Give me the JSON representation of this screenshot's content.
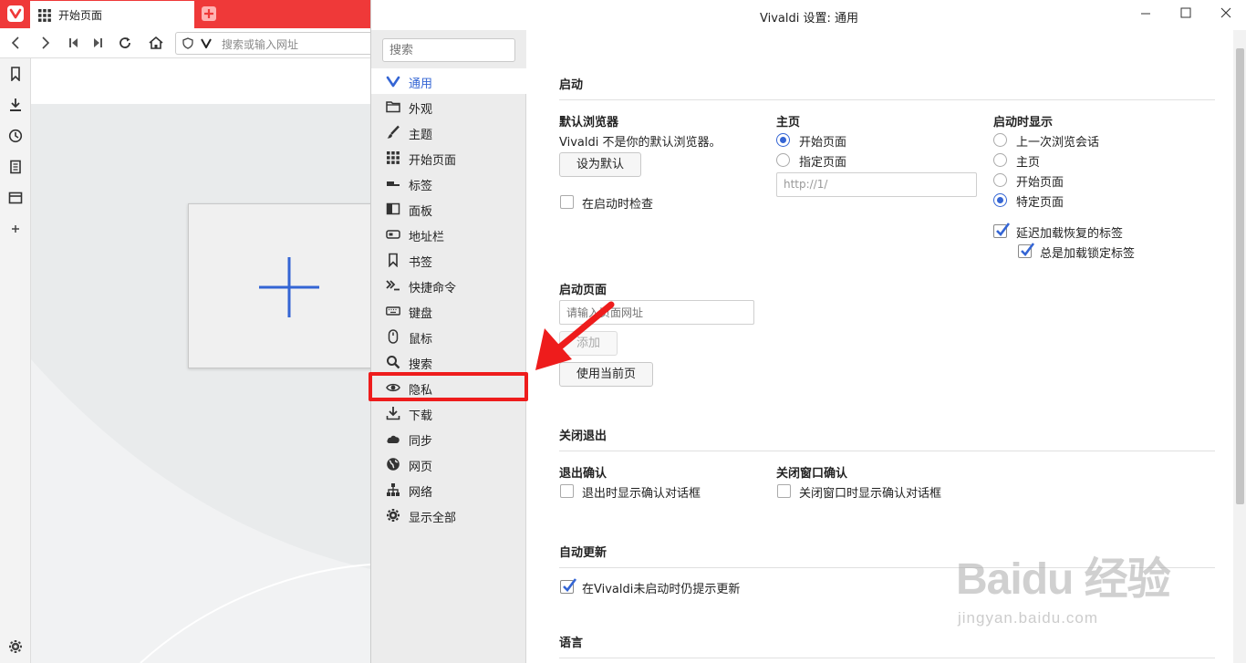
{
  "browser": {
    "tab_title": "开始页面",
    "address_placeholder": "搜索或输入网址"
  },
  "window": {
    "title": "Vivaldi 设置: 通用"
  },
  "nav": {
    "search_placeholder": "搜索",
    "items": [
      {
        "label": "通用",
        "icon": "vivaldi-icon",
        "active": true
      },
      {
        "label": "外观",
        "icon": "folder-icon"
      },
      {
        "label": "主题",
        "icon": "brush-icon"
      },
      {
        "label": "开始页面",
        "icon": "grid-icon"
      },
      {
        "label": "标签",
        "icon": "tabs-icon"
      },
      {
        "label": "面板",
        "icon": "panel-icon"
      },
      {
        "label": "地址栏",
        "icon": "address-bar-icon"
      },
      {
        "label": "书签",
        "icon": "bookmark-icon"
      },
      {
        "label": "快捷命令",
        "icon": "quick-command-icon"
      },
      {
        "label": "键盘",
        "icon": "keyboard-icon"
      },
      {
        "label": "鼠标",
        "icon": "mouse-icon"
      },
      {
        "label": "搜索",
        "icon": "search-icon"
      },
      {
        "label": "隐私",
        "icon": "eye-icon"
      },
      {
        "label": "下载",
        "icon": "download-icon"
      },
      {
        "label": "同步",
        "icon": "cloud-icon"
      },
      {
        "label": "网页",
        "icon": "globe-icon"
      },
      {
        "label": "网络",
        "icon": "network-icon"
      },
      {
        "label": "显示全部",
        "icon": "gear-icon"
      }
    ]
  },
  "startup": {
    "heading": "启动",
    "default_browser": {
      "title": "默认浏览器",
      "status": "Vivaldi 不是你的默认浏览器。",
      "button": "设为默认",
      "check_label": "在启动时检查",
      "checked": false
    },
    "homepage": {
      "title": "主页",
      "options": [
        {
          "label": "开始页面",
          "selected": true
        },
        {
          "label": "指定页面",
          "selected": false
        }
      ],
      "url_value": "http://1/"
    },
    "on_startup": {
      "title": "启动时显示",
      "options": [
        {
          "label": "上一次浏览会话",
          "selected": false
        },
        {
          "label": "主页",
          "selected": false
        },
        {
          "label": "开始页面",
          "selected": false
        },
        {
          "label": "特定页面",
          "selected": true
        }
      ],
      "lazy_load": {
        "label": "延迟加载恢复的标签",
        "checked": true
      },
      "always_pinned": {
        "label": "总是加载锁定标签",
        "checked": true
      }
    },
    "startup_pages": {
      "title": "启动页面",
      "input_placeholder": "请输入页面网址",
      "add_button": "添加",
      "use_current_button": "使用当前页"
    }
  },
  "exit": {
    "heading": "关闭退出",
    "quit_confirm": {
      "title": "退出确认",
      "label": "退出时显示确认对话框",
      "checked": false
    },
    "close_window_confirm": {
      "title": "关闭窗口确认",
      "label": "关闭窗口时显示确认对话框",
      "checked": false
    }
  },
  "updates": {
    "heading": "自动更新",
    "label": "在Vivaldi未启动时仍提示更新",
    "checked": true
  },
  "language": {
    "heading": "语言"
  },
  "watermark": {
    "main": "Baidu 经验",
    "sub": "jingyan.baidu.com"
  },
  "colors": {
    "tab_bar": "#ef3939",
    "accent": "#3465d4",
    "highlight": "#ee1c1c"
  }
}
